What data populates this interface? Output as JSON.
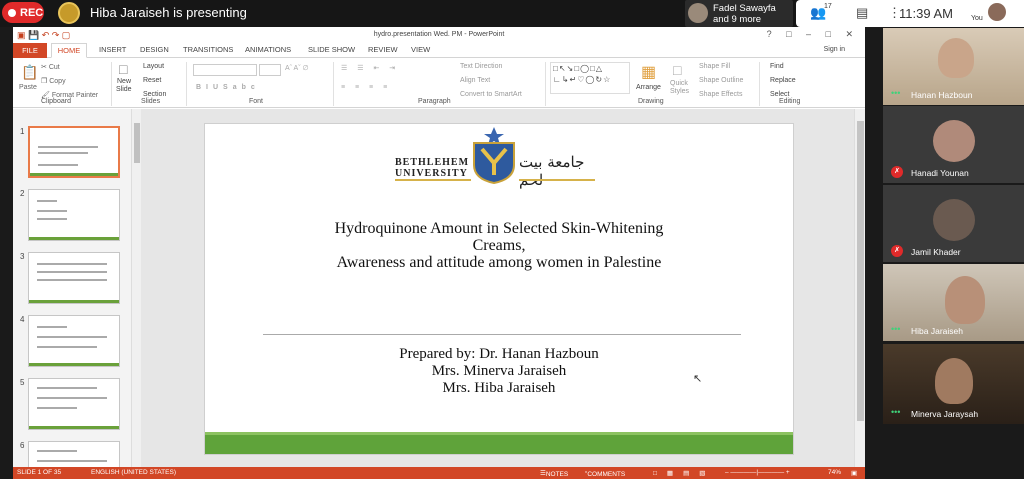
{
  "meeting": {
    "rec_label": "REC",
    "presenter_text": "Hiba Jaraiseh is presenting",
    "participant_tile_line1": "Fadel Sawayfa",
    "participant_tile_line2": "and 9 more",
    "participant_count": "17",
    "time": "11:39 AM",
    "you_label": "You"
  },
  "ppt": {
    "window_title": "hydro.presentation  Wed. PM - PowerPoint",
    "tabs": [
      "FILE",
      "HOME",
      "INSERT",
      "DESIGN",
      "TRANSITIONS",
      "ANIMATIONS",
      "SLIDE SHOW",
      "REVIEW",
      "VIEW"
    ],
    "signin": "Sign in",
    "ribbon": {
      "paste": "Paste",
      "cut": "Cut",
      "copy": "Copy",
      "format_painter": "Format Painter",
      "new_slide": "New",
      "new_slide2": "Slide",
      "layout": "Layout",
      "reset": "Reset",
      "section": "Section",
      "text_direction": "Text Direction",
      "align_text": "Align Text",
      "convert_smartart": "Convert to SmartArt",
      "arrange": "Arrange",
      "quick_styles": "Quick",
      "quick_styles2": "Styles",
      "shape_fill": "Shape Fill",
      "shape_outline": "Shape Outline",
      "shape_effects": "Shape Effects",
      "find": "Find",
      "replace": "Replace",
      "select": "Select",
      "groups": [
        "Clipboard",
        "Slides",
        "Font",
        "Paragraph",
        "Drawing",
        "Editing"
      ]
    },
    "thumbnail_numbers": [
      "1",
      "2",
      "3",
      "4",
      "5",
      "6"
    ],
    "slide": {
      "uni_name_en_1": "Bethlehem",
      "uni_name_en_2": "University",
      "uni_name_ar": "جامعة بيت لحم",
      "title_line1": "Hydroquinone Amount in Selected Skin-Whitening",
      "title_line2": "Creams,",
      "title_line3": "Awareness and attitude among women in Palestine",
      "prepared_line1": "Prepared by: Dr. Hanan Hazboun",
      "prepared_line2": "Mrs. Minerva Jaraiseh",
      "prepared_line3": "Mrs. Hiba Jaraiseh"
    },
    "status": {
      "slide_of": "SLIDE 1 OF 35",
      "language": "ENGLISH (UNITED STATES)",
      "notes": "NOTES",
      "comments": "COMMENTS",
      "zoom": "74%"
    }
  },
  "participants": [
    {
      "name": "Hanan Hazboun",
      "muted": false
    },
    {
      "name": "Hanadi Younan",
      "muted": true
    },
    {
      "name": "Jamil Khader",
      "muted": true
    },
    {
      "name": "Hiba Jaraiseh",
      "muted": false
    },
    {
      "name": "Minerva Jaraysah",
      "muted": false
    }
  ],
  "colors": {
    "accent": "#d24726",
    "rec": "#e02a2a",
    "slide_green": "#5fa33a"
  }
}
